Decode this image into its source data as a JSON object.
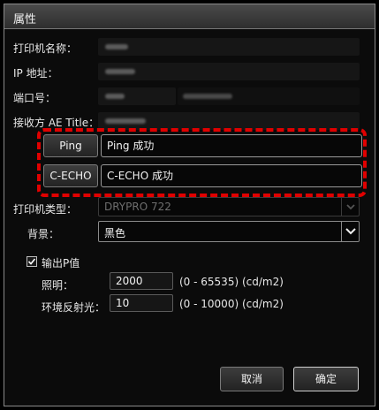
{
  "dialog": {
    "title": "属性"
  },
  "fields": {
    "printer_name_label": "打印机名称：",
    "ip_label": "IP 地址：",
    "port_label": "端口号：",
    "ae_title_label": "接收方 AE Title："
  },
  "tests": {
    "ping_button": "Ping",
    "ping_result": "Ping 成功",
    "echo_button": "C-ECHO",
    "echo_result": "C-ECHO 成功"
  },
  "printer_type": {
    "label": "打印机类型：",
    "value": "DRYPRO 722"
  },
  "background": {
    "label": "背景：",
    "value": "黑色"
  },
  "p_value": {
    "checkbox_label": "输出P值",
    "checked": true,
    "illumination_label": "照明：",
    "illumination_value": "2000",
    "illumination_range": "(0 - 65535) (cd/m2)",
    "ambient_label": "环境反射光：",
    "ambient_value": "10",
    "ambient_range": "(0 - 10000) (cd/m2)"
  },
  "footer": {
    "cancel": "取消",
    "ok": "确定"
  },
  "colors": {
    "highlight_dash": "#e00000",
    "background": "#0b0b0b"
  }
}
